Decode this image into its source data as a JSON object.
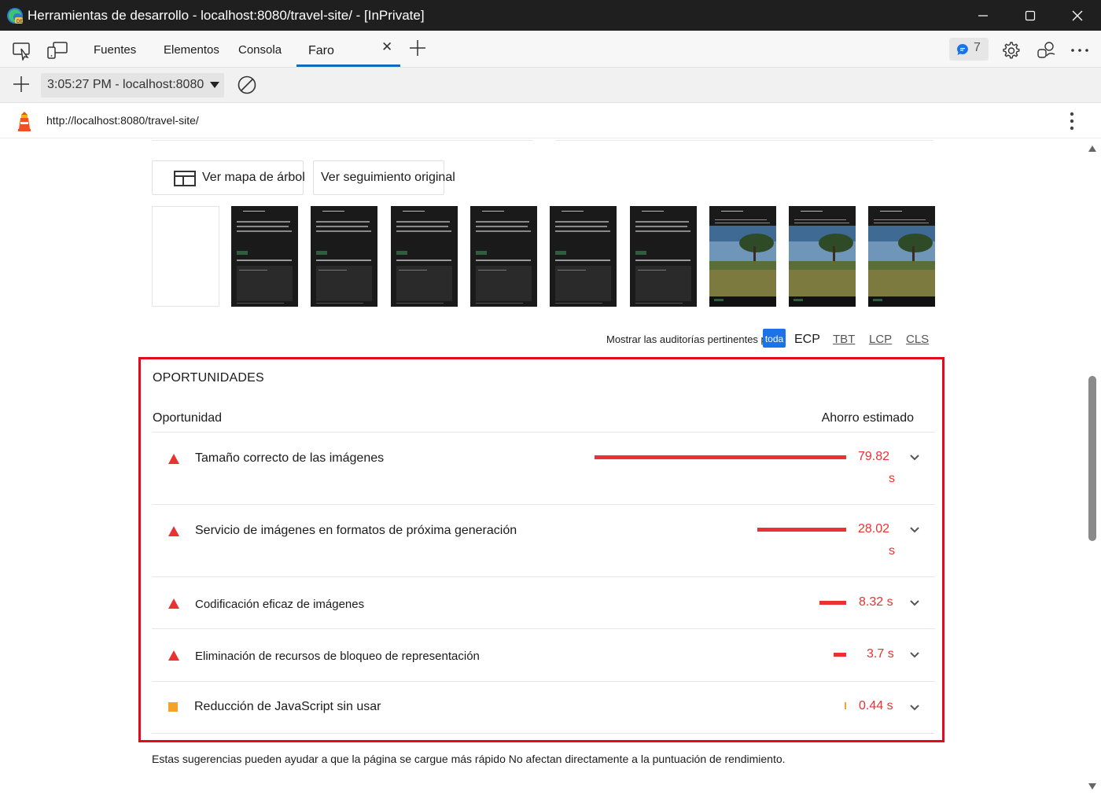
{
  "window": {
    "title": "Herramientas de desarrollo - localhost:8080/travel-site/ - [InPrivate]"
  },
  "tabs": [
    {
      "label": "Fuentes"
    },
    {
      "label": "Elementos"
    },
    {
      "label": "Consola"
    },
    {
      "label": "Faro",
      "active": true
    }
  ],
  "issues_count": "7",
  "toolbar": {
    "report_time": "3:05:27 PM - localhost:8080"
  },
  "url": "http://localhost:8080/travel-site/",
  "view_buttons": {
    "treemap": "Ver mapa de árbol",
    "original_trace": "Ver seguimiento original"
  },
  "filmstrip": {
    "frames": [
      "blank",
      "dark",
      "dark",
      "dark",
      "dark",
      "dark",
      "dark",
      "photo",
      "photo",
      "photo"
    ]
  },
  "filter": {
    "label": "Mostrar las auditorías pertinentes pa",
    "all": "toda",
    "chips": [
      "ECP",
      "TBT",
      "LCP",
      "CLS"
    ]
  },
  "opportunities": {
    "section_title": "OPORTUNIDADES",
    "col_opportunity": "Oportunidad",
    "col_savings": "Ahorro estimado",
    "items": [
      {
        "title": "Tamaño correcto de las imágenes",
        "value": "79.82",
        "unit": "s",
        "severity": "fail",
        "bar_fraction": 1.0
      },
      {
        "title": "Servicio de imágenes en formatos de próxima generación",
        "value": "28.02",
        "unit": "s",
        "severity": "fail",
        "bar_fraction": 0.354
      },
      {
        "title": "Codificación eficaz de imágenes",
        "value": "8.32 s",
        "severity": "fail",
        "bar_fraction": 0.106
      },
      {
        "title": "Eliminación de recursos de bloqueo de representación",
        "value": "3.7 s",
        "severity": "fail",
        "bar_fraction": 0.05
      },
      {
        "title": "Reducción de JavaScript sin usar",
        "value": "0.44 s",
        "severity": "average",
        "bar_fraction": 0.006
      }
    ]
  },
  "footnote": "Estas sugerencias pueden ayudar a que la página se cargue más rápido No afectan directamente a la puntuación de rendimiento.",
  "colors": {
    "fail": "#eb3131",
    "average": "#f4a228",
    "accent": "#0f6cbd",
    "highlight_border": "#e00b1c"
  }
}
